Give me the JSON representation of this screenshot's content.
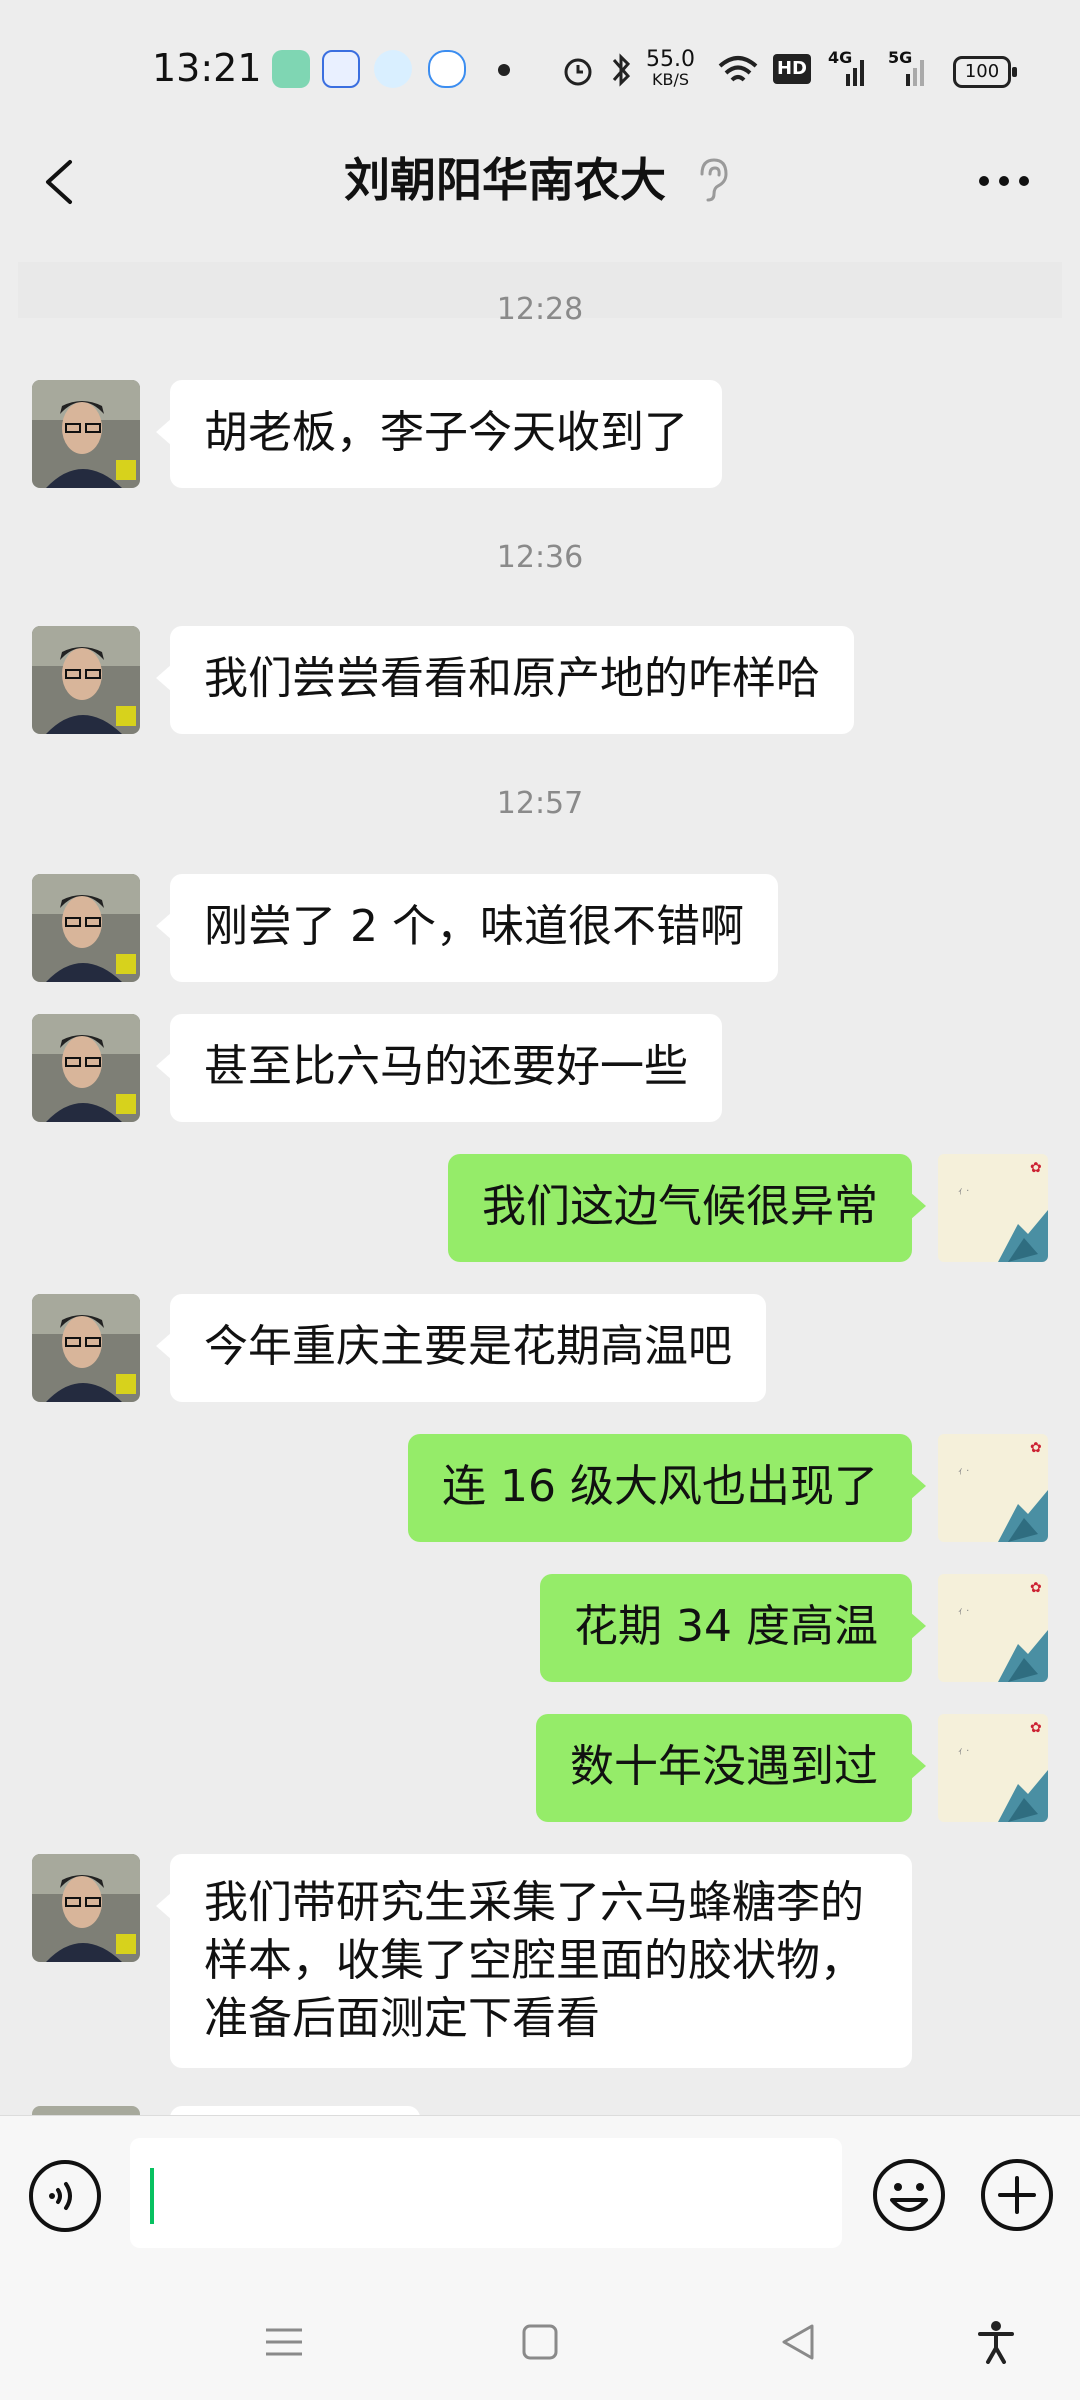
{
  "status_bar": {
    "time": "13:21",
    "net_speed_top": "55.0",
    "net_speed_unit": "KB/S",
    "hd_badge": "HD",
    "net_4g": "4G",
    "net_5g": "5G",
    "battery": "100"
  },
  "header": {
    "title": "刘朝阳华南农大"
  },
  "messages": [
    {
      "type": "time",
      "text": "12:28"
    },
    {
      "type": "in",
      "text": "胡老板，李子今天收到了"
    },
    {
      "type": "time",
      "text": "12:36"
    },
    {
      "type": "in",
      "text": "我们尝尝看看和原产地的咋样哈"
    },
    {
      "type": "time",
      "text": "12:57"
    },
    {
      "type": "in",
      "text": "刚尝了 2 个，味道很不错啊"
    },
    {
      "type": "in",
      "text": "甚至比六马的还要好一些"
    },
    {
      "type": "out",
      "text": "我们这边气候很异常"
    },
    {
      "type": "in",
      "text": "今年重庆主要是花期高温吧"
    },
    {
      "type": "out",
      "text": "连 16 级大风也出现了"
    },
    {
      "type": "out",
      "text": "花期 34 度高温"
    },
    {
      "type": "out",
      "text": "数十年没遇到过"
    },
    {
      "type": "in",
      "text": "我们带研究生采集了六马蜂糖李的样本，收集了空腔里面的胶状物，准备后面测定下看看"
    }
  ],
  "input": {
    "value": "",
    "placeholder": ""
  },
  "colors": {
    "background": "#ededed",
    "out_bubble": "#95ec69",
    "in_bubble": "#ffffff",
    "caret": "#07c160"
  },
  "icons": {
    "back": "chevron-left-icon",
    "ear": "ear-icon",
    "more": "more-icon",
    "voice": "voice-icon",
    "emoji": "emoji-icon",
    "plus": "plus-icon"
  }
}
